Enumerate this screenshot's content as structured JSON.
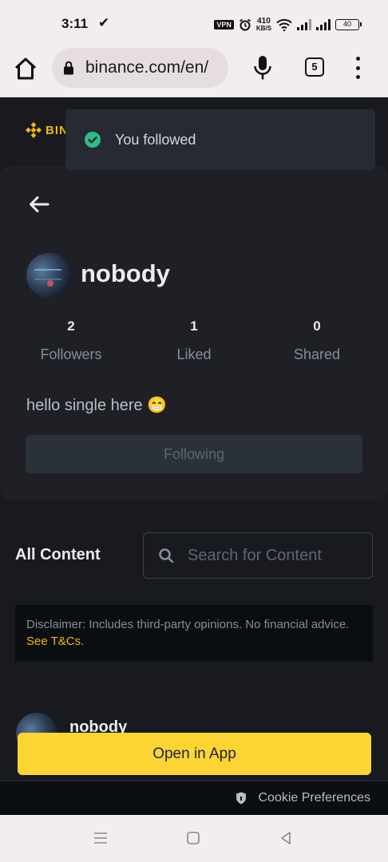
{
  "status_bar": {
    "time": "3:11",
    "check": "✔",
    "vpn": "VPN",
    "speed_value": "410",
    "speed_unit": "KB/S",
    "battery": "40"
  },
  "browser": {
    "url": "binance.com/en/",
    "tab_count": "5"
  },
  "site": {
    "logo_text": "BIN",
    "brand_color": "#f0b90b"
  },
  "toast": {
    "message": "You followed"
  },
  "profile": {
    "username": "nobody",
    "stats": [
      {
        "value": "2",
        "label": "Followers"
      },
      {
        "value": "1",
        "label": "Liked"
      },
      {
        "value": "0",
        "label": "Shared"
      }
    ],
    "bio": "hello single here 😁",
    "following_label": "Following"
  },
  "content": {
    "heading": "All Content",
    "search_placeholder": "Search for Content",
    "disclaimer_text": "Disclaimer: Includes third-party opinions. No financial advice. ",
    "disclaimer_link": "See T&Cs."
  },
  "post": {
    "author": "nobody"
  },
  "open_app_label": "Open in App",
  "cookie_label": "Cookie Preferences"
}
